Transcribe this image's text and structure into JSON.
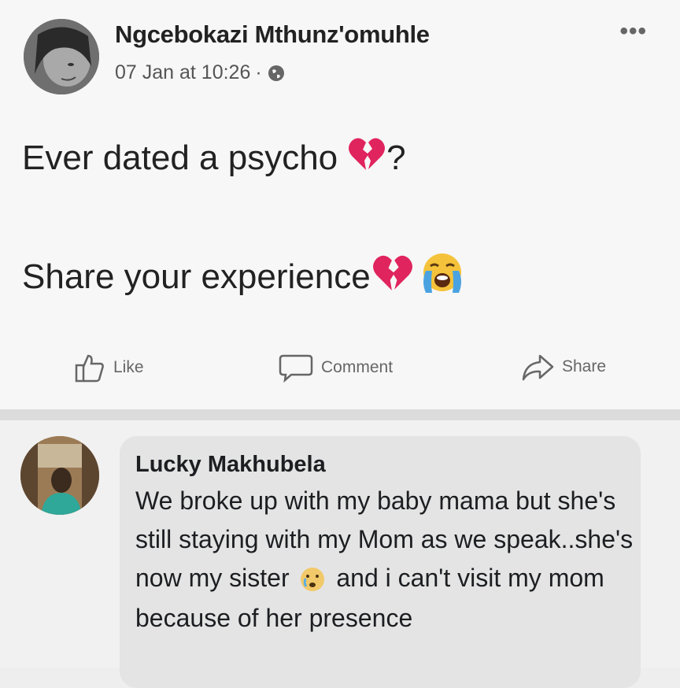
{
  "post": {
    "author": "Ngcebokazi Mthunz'omuhle",
    "date": "07 Jan at 10:26",
    "separator": "·",
    "more_label": "•••",
    "line1_text": "Ever dated a psycho",
    "line1_suffix": "?",
    "line2_text": "Share your experience",
    "icons": {
      "privacy": "globe-icon",
      "broken_heart": "broken-heart-emoji",
      "crying_face": "loudly-crying-emoji"
    }
  },
  "actions": {
    "like": "Like",
    "comment": "Comment",
    "share": "Share"
  },
  "comment": {
    "author": "Lucky Makhubela",
    "text_part1": "We broke up with my baby mama but she's still staying with my Mom as we speak..she's now my sister",
    "text_part2": "and i can't visit my mom because of her presence",
    "icon": "crying-face-emoji"
  },
  "colors": {
    "post_bg": "#f7f7f7",
    "comment_bubble": "#e4e4e4",
    "heart_red": "#e0245e"
  }
}
